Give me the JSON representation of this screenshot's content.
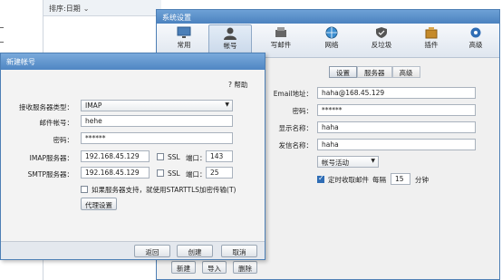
{
  "background": {
    "sort_label": "排序:日期"
  },
  "settings": {
    "title": "系统设置",
    "toolbar": [
      {
        "label": "常用",
        "icon": "monitor-icon"
      },
      {
        "label": "帐号",
        "icon": "user-icon"
      },
      {
        "label": "写邮件",
        "icon": "compose-icon"
      },
      {
        "label": "网络",
        "icon": "globe-icon"
      },
      {
        "label": "反垃圾",
        "icon": "shield-icon"
      },
      {
        "label": "插件",
        "icon": "plugin-icon"
      },
      {
        "label": "高级",
        "icon": "gear-icon"
      }
    ],
    "active_tab_index": 1,
    "subtabs": [
      "设置",
      "服务器",
      "高级"
    ],
    "active_subtab_index": 0,
    "fields": {
      "email_label": "Email地址：",
      "email_value": "haha@168.45.129",
      "password_label": "密码：",
      "password_value": "******",
      "display_name_label": "显示名称：",
      "display_name_value": "haha",
      "sender_name_label": "发信名称：",
      "sender_name_value": "haha",
      "account_status": "帐号活动",
      "timer_label": "定时收取邮件",
      "interval_prefix": "每隔",
      "interval_value": "15",
      "interval_unit": "分钟"
    },
    "timer_checked": true,
    "bottom_buttons": [
      "新建",
      "导入",
      "删除"
    ]
  },
  "dialog": {
    "title": "新建帐号",
    "help": "帮助",
    "server_type_label": "接收服务器类型：",
    "server_type_value": "IMAP",
    "email_label": "邮件帐号：",
    "email_value": "hehe",
    "password_label": "密码：",
    "password_value": "******",
    "imap_label": "IMAP服务器：",
    "imap_value": "192.168.45.129",
    "imap_ssl": "SSL",
    "imap_port_label": "端口：",
    "imap_port": "143",
    "smtp_label": "SMTP服务器：",
    "smtp_value": "192.168.45.129",
    "smtp_ssl": "SSL",
    "smtp_port_label": "端口：",
    "smtp_port": "25",
    "starttls_label": "如果服务器支持，就使用STARTTLS加密传输(T)",
    "proxy_button": "代理设置",
    "buttons": [
      "返回",
      "创建",
      "取消"
    ]
  },
  "colors": {
    "title_blue": "#4f86c3",
    "accent": "#2f6db5"
  }
}
